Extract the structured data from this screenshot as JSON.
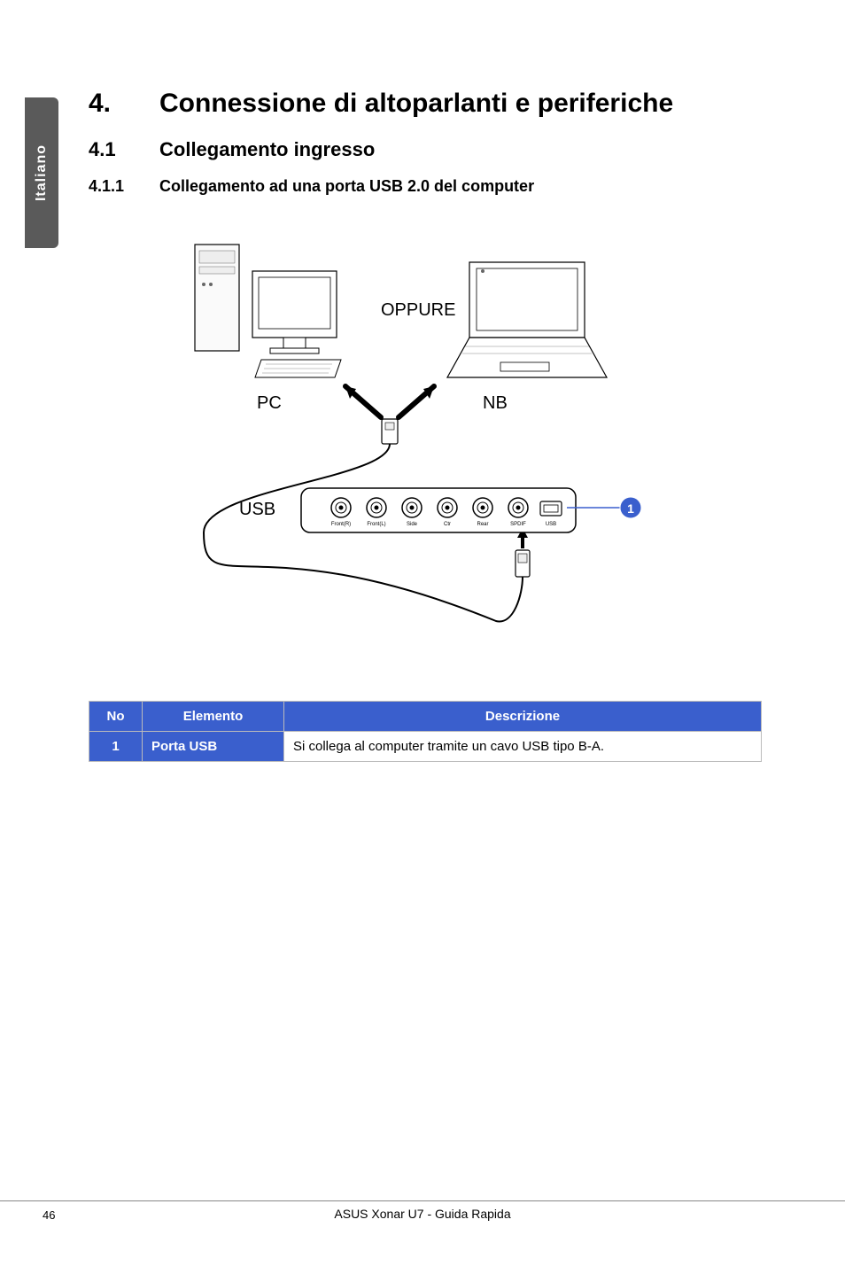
{
  "side_tab": "Italiano",
  "heading1": {
    "num": "4.",
    "text": "Connessione di altoparlanti e periferiche"
  },
  "heading2": {
    "num": "4.1",
    "text": "Collegamento ingresso"
  },
  "heading3": {
    "num": "4.1.1",
    "text": "Collegamento ad una porta USB 2.0 del computer"
  },
  "diagram": {
    "connector_word": "OPPURE",
    "pc_label": "PC",
    "nb_label": "NB",
    "usb_label": "USB",
    "callout_1": "1",
    "ports": [
      "Front(R)",
      "Front(L)",
      "Side",
      "Ctr",
      "Rear",
      "SPDIF",
      "USB"
    ]
  },
  "table": {
    "headers": {
      "no": "No",
      "elemento": "Elemento",
      "descrizione": "Descrizione"
    },
    "rows": [
      {
        "no": "1",
        "elemento": "Porta USB",
        "descrizione": "Si collega al computer tramite un cavo USB tipo B-A."
      }
    ]
  },
  "footer": {
    "page": "46",
    "text": "ASUS Xonar U7 - Guida Rapida"
  }
}
